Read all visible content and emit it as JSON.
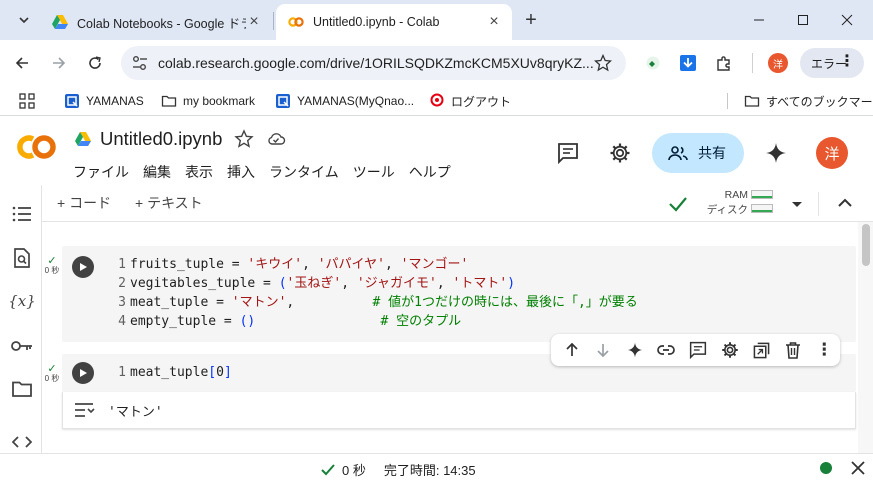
{
  "browser": {
    "tabs": [
      {
        "title": "Colab Notebooks - Google ドラ",
        "active": false,
        "icon": "google-drive-icon"
      },
      {
        "title": "Untitled0.ipynb - Colab",
        "active": true,
        "icon": "colab-icon"
      }
    ],
    "url": "colab.research.google.com/drive/1ORILSQDKZmcKCM5XUv8qryKZ...",
    "profile_initial": "洋",
    "error_button": "エラー",
    "bookmarks": [
      {
        "label": "YAMANAS",
        "icon": "bookmark-site-icon"
      },
      {
        "label": "my bookmark",
        "icon": "folder-icon"
      },
      {
        "label": "YAMANAS(MyQnao...",
        "icon": "bookmark-site-icon"
      },
      {
        "label": "ログアウト",
        "icon": "mufg-icon"
      }
    ],
    "all_bookmarks": "すべてのブックマーク"
  },
  "colab": {
    "notebook_title": "Untitled0.ipynb",
    "menu": [
      "ファイル",
      "編集",
      "表示",
      "挿入",
      "ランタイム",
      "ツール",
      "ヘルプ"
    ],
    "share_label": "共有",
    "user_initial": "洋",
    "add_code": "+ コード",
    "add_text": "+ テキスト",
    "ram_label": "RAM",
    "disk_label": "ディスク"
  },
  "cells": [
    {
      "status_time": "0 秒",
      "lines": [
        {
          "n": "1",
          "html": "fruits_tuple = <span class=\"s\">'キウイ'</span>, <span class=\"s\">'パパイヤ'</span>, <span class=\"s\">'マンゴー'</span>"
        },
        {
          "n": "2",
          "html": "vegitables_tuple = <span class=\"p\">(</span><span class=\"s\">'玉ねぎ'</span>, <span class=\"s\">'ジャガイモ'</span>, <span class=\"s\">'トマト'</span><span class=\"p\">)</span>"
        },
        {
          "n": "3",
          "html": "meat_tuple = <span class=\"s\">'マトン'</span>,          <span class=\"c\"># 値が1つだけの時には、最後に「,」が要る</span>"
        },
        {
          "n": "4",
          "html": "empty_tuple = <span class=\"p\">()</span>                <span class=\"c\"># 空のタプル</span>"
        }
      ]
    },
    {
      "status_time": "0 秒",
      "lines": [
        {
          "n": "1",
          "html": "meat_tuple<span class=\"p\">[</span>0<span class=\"p\">]</span>"
        }
      ],
      "output": "'マトン'"
    }
  ],
  "status": {
    "elapsed": "0 秒",
    "completed": "完了時間: 14:35"
  }
}
